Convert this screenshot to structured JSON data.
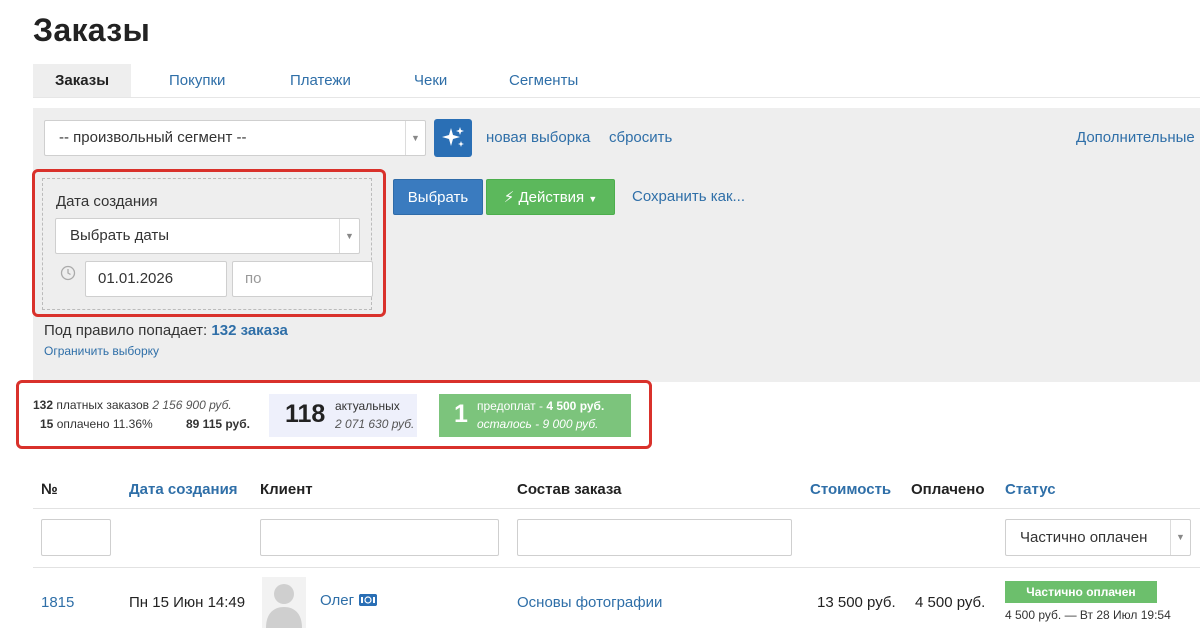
{
  "page_title": "Заказы",
  "tabs": [
    {
      "label": "Заказы",
      "active": true
    },
    {
      "label": "Покупки",
      "active": false
    },
    {
      "label": "Платежи",
      "active": false
    },
    {
      "label": "Чеки",
      "active": false
    },
    {
      "label": "Сегменты",
      "active": false
    }
  ],
  "filters": {
    "segment_select": "-- произвольный сегмент --",
    "new_selection": "новая выборка",
    "reset": "сбросить",
    "more": "Дополнительные",
    "date_label": "Дата создания",
    "date_select": "Выбрать даты",
    "date_from": "01.01.2026",
    "date_to_placeholder": "по",
    "select_button": "Выбрать",
    "actions_button": "Действия",
    "save_as": "Сохранить как...",
    "rule_prefix": "Под правило попадает:",
    "rule_count": "132 заказа",
    "limit_link": "Ограничить выборку"
  },
  "stats": {
    "paid_count": "132",
    "paid_label": "платных заказов",
    "paid_sum": "2 156 900 руб.",
    "paid_done_count": "15",
    "paid_done_label": "оплачено 11.36%",
    "paid_done_sum": "89 115 руб.",
    "actual_count": "118",
    "actual_label": "актуальных",
    "actual_sum": "2 071 630 руб.",
    "prepay_count": "1",
    "prepay_label": "предоплат - ",
    "prepay_sum": "4 500 руб.",
    "remaining_label": "осталось - ",
    "remaining_sum": "9 000 руб."
  },
  "table": {
    "columns": {
      "number": "№",
      "created": "Дата создания",
      "client": "Клиент",
      "composition": "Состав заказа",
      "cost": "Стоимость",
      "paid": "Оплачено",
      "status": "Статус"
    },
    "status_filter": "Частично оплачен",
    "rows": [
      {
        "id": "1815",
        "created": "Пн 15 Июн 14:49",
        "client": "Олег",
        "composition": "Основы фотографии",
        "cost": "13 500 руб.",
        "paid": "4 500 руб.",
        "status": "Частично оплачен",
        "status_note": "4 500 руб. — Вт 28 Июл 19:54"
      }
    ]
  },
  "colors": {
    "link": "#2f6fa8",
    "primary_button": "#3a7bbf",
    "success_button": "#5cb85c",
    "highlight_border": "#d9312b"
  }
}
